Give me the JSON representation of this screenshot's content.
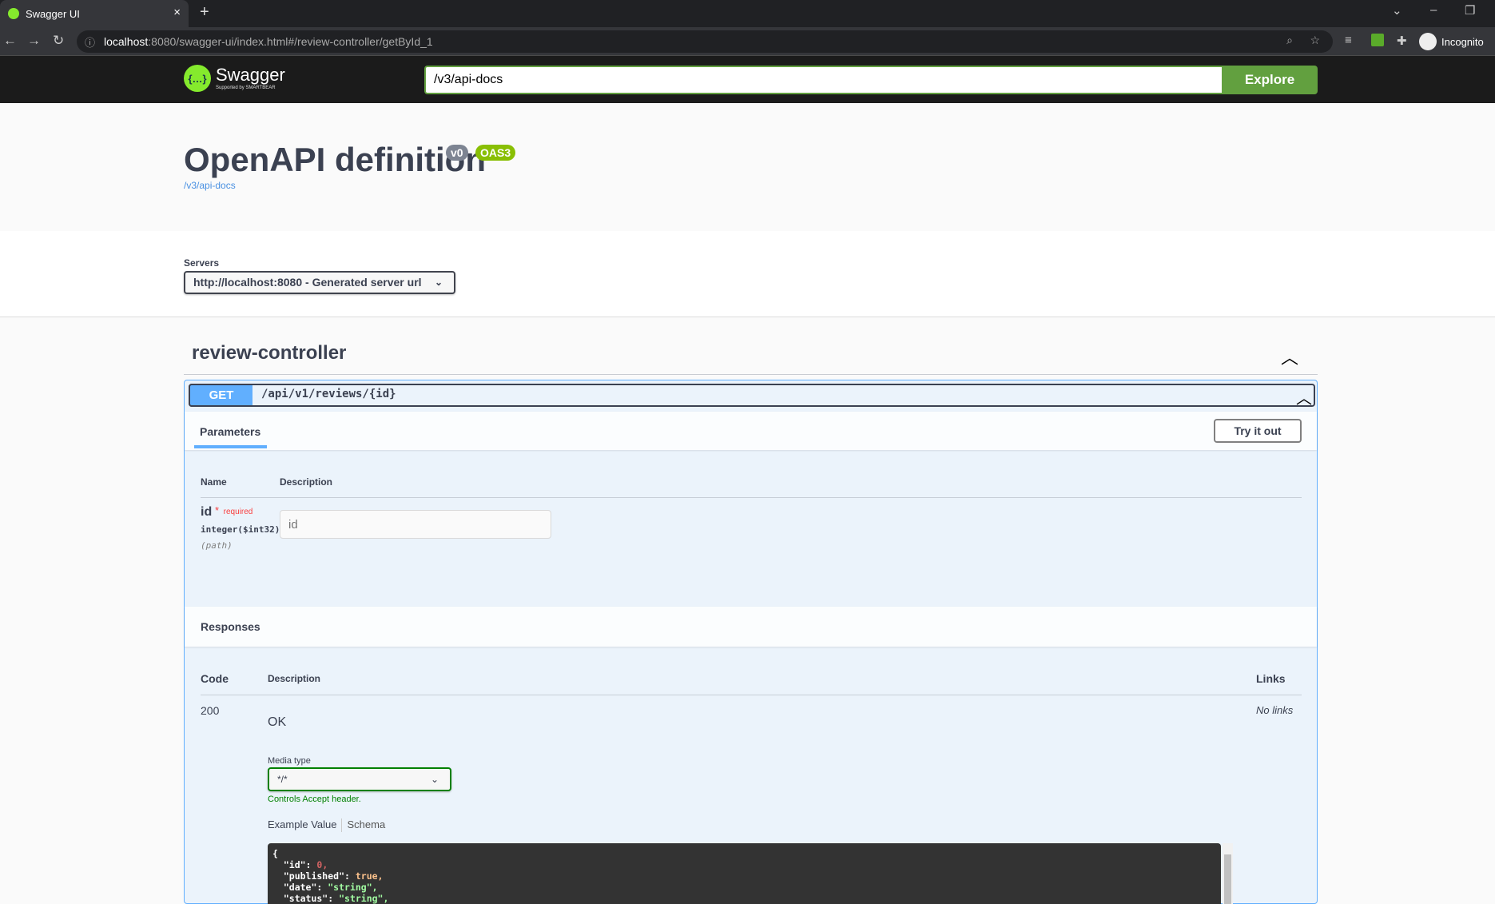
{
  "browser": {
    "tab_title": "Swagger UI",
    "url_host": "localhost",
    "url_rest": ":8080/swagger-ui/index.html#/review-controller/getById_1",
    "profile_label": "Incognito"
  },
  "topbar": {
    "logo_text": "Swagger",
    "logo_sub": "Supported by SMARTBEAR",
    "url_value": "/v3/api-docs",
    "explore_label": "Explore"
  },
  "info": {
    "title": "OpenAPI definition",
    "version_badge": "v0",
    "oas_badge": "OAS3",
    "link": "/v3/api-docs"
  },
  "servers": {
    "label": "Servers",
    "selected": "http://localhost:8080 - Generated server url"
  },
  "tag": {
    "name": "review-controller"
  },
  "operation": {
    "method": "GET",
    "path": "/api/v1/reviews/{id}",
    "parameters_tab": "Parameters",
    "try_label": "Try it out",
    "col_name": "Name",
    "col_description": "Description",
    "param": {
      "name": "id",
      "required_star": "*",
      "required_label": "required",
      "type": "integer($int32)",
      "in": "(path)",
      "placeholder": "id"
    },
    "responses_title": "Responses",
    "resp_cols": {
      "code": "Code",
      "description": "Description",
      "links": "Links"
    },
    "response": {
      "code": "200",
      "description": "OK",
      "links": "No links",
      "media_type_label": "Media type",
      "media_type": "*/*",
      "controls_note": "Controls Accept header.",
      "example_tab": "Example Value",
      "schema_tab": "Schema",
      "example_lines": [
        {
          "key": "{",
          "val": "",
          "cls": "k"
        },
        {
          "key": "  \"id\": ",
          "val": "0,",
          "cls": "n"
        },
        {
          "key": "  \"published\": ",
          "val": "true,",
          "cls": "b"
        },
        {
          "key": "  \"date\": ",
          "val": "\"string\",",
          "cls": "s"
        },
        {
          "key": "  \"status\": ",
          "val": "\"string\",",
          "cls": "s"
        }
      ]
    }
  }
}
